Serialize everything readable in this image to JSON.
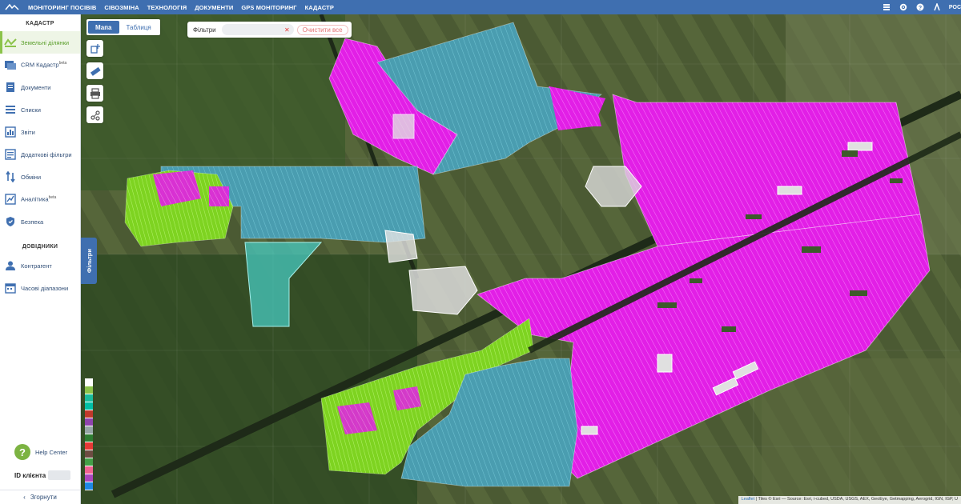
{
  "topbar": {
    "nav": [
      "МОНІТОРИНГ ПОСІВІВ",
      "СІВОЗМІНА",
      "ТЕХНОЛОГІЯ",
      "ДОКУМЕНТИ",
      "GPS МОНІТОРИНГ",
      "КАДАСТР"
    ],
    "lang": "РОС"
  },
  "sidebar": {
    "section_cadastre": "КАДАСТР",
    "items": [
      {
        "label": "Земельні ділянки",
        "icon": "land-plots-icon",
        "active": true
      },
      {
        "label": "CRM Кадастр",
        "sup": "beta",
        "icon": "crm-icon"
      },
      {
        "label": "Документи",
        "icon": "documents-icon"
      },
      {
        "label": "Списки",
        "icon": "lists-icon"
      },
      {
        "label": "Звіти",
        "icon": "reports-icon"
      },
      {
        "label": "Додаткові фільтри",
        "icon": "extra-filters-icon"
      },
      {
        "label": "Обміни",
        "icon": "exchange-icon"
      },
      {
        "label": "Аналітика",
        "sup": "beta",
        "icon": "analytics-icon"
      },
      {
        "label": "Безпека",
        "icon": "security-icon"
      }
    ],
    "section_reference": "ДОВІДНИКИ",
    "ref_items": [
      {
        "label": "Контрагент",
        "icon": "contractor-icon"
      },
      {
        "label": "Часові діапазони",
        "icon": "calendar-icon"
      }
    ],
    "help_label": "Help Center",
    "client_label": "ID клієнта",
    "collapse_label": "Згорнути"
  },
  "map": {
    "view_map": "Мапа",
    "view_table": "Таблиця",
    "filters_label": "Фільтри",
    "clear_all": "Очистити все",
    "filters_tab": "Фільтри",
    "legend_colors": [
      "#ffffff",
      "#8bc34a",
      "#1abc9c",
      "#00bfa5",
      "#c0392b",
      "#8e44ad",
      "#95a5a6",
      "#2e7d32",
      "#e53935",
      "#6d4c41",
      "#43a047",
      "#f06292",
      "#ab47bc",
      "#1e88e5"
    ],
    "attribution_link": "Leaflet",
    "attribution_text": " | Tiles © Esri — Source: Esri, i-cubed, USDA, USGS, AEX, GeoEye, Getmapping, Aerogrid, IGN, IGP, U"
  },
  "colors": {
    "accent": "#3f6fb0",
    "active_green": "#8bc34a",
    "magenta": "#e01ee0",
    "teal": "#3fa8b8",
    "lime": "#7ed321"
  }
}
